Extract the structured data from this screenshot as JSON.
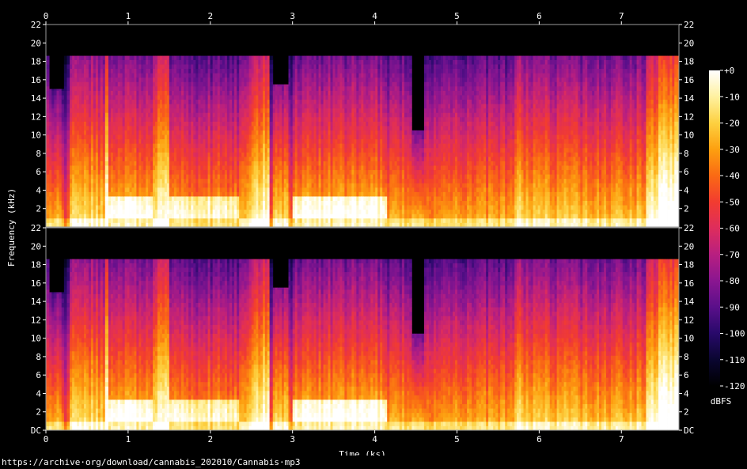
{
  "chart_data": {
    "type": "heatmap",
    "subtype": "spectrogram",
    "channels": 2,
    "xlabel": "Time (ks)",
    "ylabel": "Frequency (kHz)",
    "xlim": [
      0,
      7.7
    ],
    "ylim": [
      0,
      22
    ],
    "x_ticks": [
      "0",
      "1",
      "2",
      "3",
      "4",
      "5",
      "6",
      "7"
    ],
    "y_ticks": [
      "DC",
      "2",
      "4",
      "6",
      "8",
      "10",
      "12",
      "14",
      "16",
      "18",
      "20",
      "22"
    ],
    "colorbar": {
      "label": "dBFS",
      "range": [
        -120,
        0
      ],
      "ticks": [
        "+0",
        "-10",
        "-20",
        "-30",
        "-40",
        "-50",
        "-60",
        "-70",
        "-80",
        "-90",
        "-100",
        "-110",
        "-120"
      ],
      "colormap": [
        "#000000",
        "#0a0630",
        "#28096a",
        "#5a0f8a",
        "#8a1690",
        "#b81f80",
        "#de2d5c",
        "#f23c30",
        "#fa6a14",
        "#fda010",
        "#fdd040",
        "#fff1a0",
        "#ffffff"
      ]
    },
    "lowpass_cutoff_khz": 18.6,
    "segments": [
      {
        "start": 0.0,
        "end": 0.04,
        "level": 0.55
      },
      {
        "start": 0.04,
        "end": 0.22,
        "level": 0.5,
        "cutoff_khz": 15
      },
      {
        "start": 0.22,
        "end": 0.29,
        "level": 0.35
      },
      {
        "start": 0.29,
        "end": 0.72,
        "level": 0.6
      },
      {
        "start": 0.72,
        "end": 0.76,
        "level": 0.75
      },
      {
        "start": 0.76,
        "end": 1.3,
        "level": 0.55,
        "hot_band_khz": 3
      },
      {
        "start": 1.3,
        "end": 1.5,
        "level": 0.7
      },
      {
        "start": 1.5,
        "end": 2.35,
        "level": 0.5,
        "hot_band_khz": 3
      },
      {
        "start": 2.35,
        "end": 2.5,
        "level": 0.6
      },
      {
        "start": 2.5,
        "end": 2.72,
        "level": 0.72
      },
      {
        "start": 2.72,
        "end": 2.76,
        "level": 0.35
      },
      {
        "start": 2.76,
        "end": 2.95,
        "level": 0.6,
        "cutoff_khz": 15.5
      },
      {
        "start": 2.95,
        "end": 3.0,
        "level": 0.4
      },
      {
        "start": 3.0,
        "end": 4.15,
        "level": 0.55,
        "hot_band_khz": 3.2
      },
      {
        "start": 4.15,
        "end": 4.45,
        "level": 0.5
      },
      {
        "start": 4.45,
        "end": 4.6,
        "level": 0.55,
        "cutoff_khz": 10.5
      },
      {
        "start": 4.6,
        "end": 5.7,
        "level": 0.5
      },
      {
        "start": 5.7,
        "end": 5.78,
        "level": 0.65
      },
      {
        "start": 5.78,
        "end": 6.1,
        "level": 0.58
      },
      {
        "start": 6.1,
        "end": 7.3,
        "level": 0.55
      },
      {
        "start": 7.3,
        "end": 7.45,
        "level": 0.72
      },
      {
        "start": 7.45,
        "end": 7.7,
        "level": 0.82
      }
    ]
  },
  "source_url": "https://archive·org/download/cannabis_202010/Cannabis·mp3"
}
